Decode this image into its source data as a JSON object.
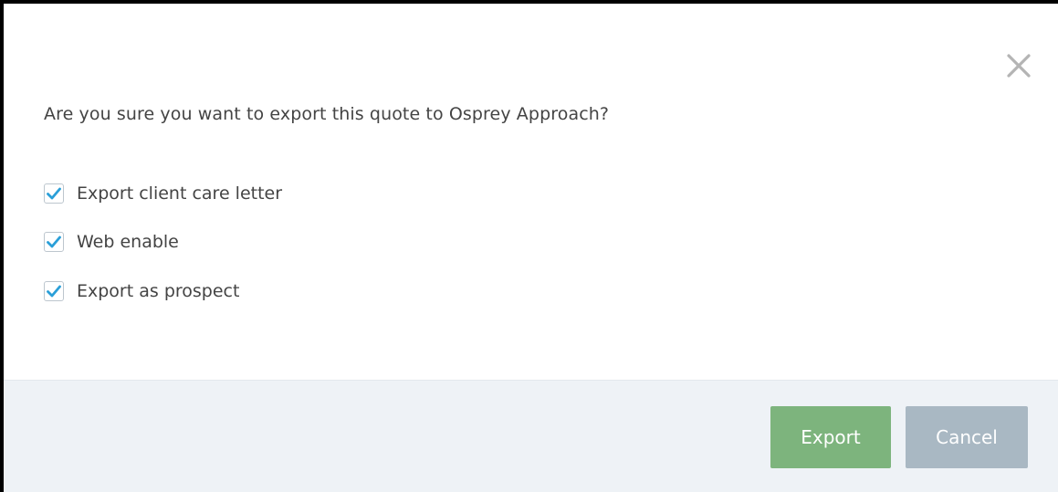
{
  "dialog": {
    "question": "Are you sure you want to export this quote to Osprey Approach?",
    "options": [
      {
        "label": "Export client care letter",
        "checked": true
      },
      {
        "label": "Web enable",
        "checked": true
      },
      {
        "label": "Export as prospect",
        "checked": true
      }
    ],
    "buttons": {
      "export_label": "Export",
      "cancel_label": "Cancel"
    },
    "icons": {
      "close": "close-icon",
      "check": "checkmark-icon"
    },
    "colors": {
      "export_button": "#7db47d",
      "cancel_button": "#a9b8c3",
      "checkmark": "#2a9fd8",
      "footer_background": "#eef2f6"
    }
  }
}
